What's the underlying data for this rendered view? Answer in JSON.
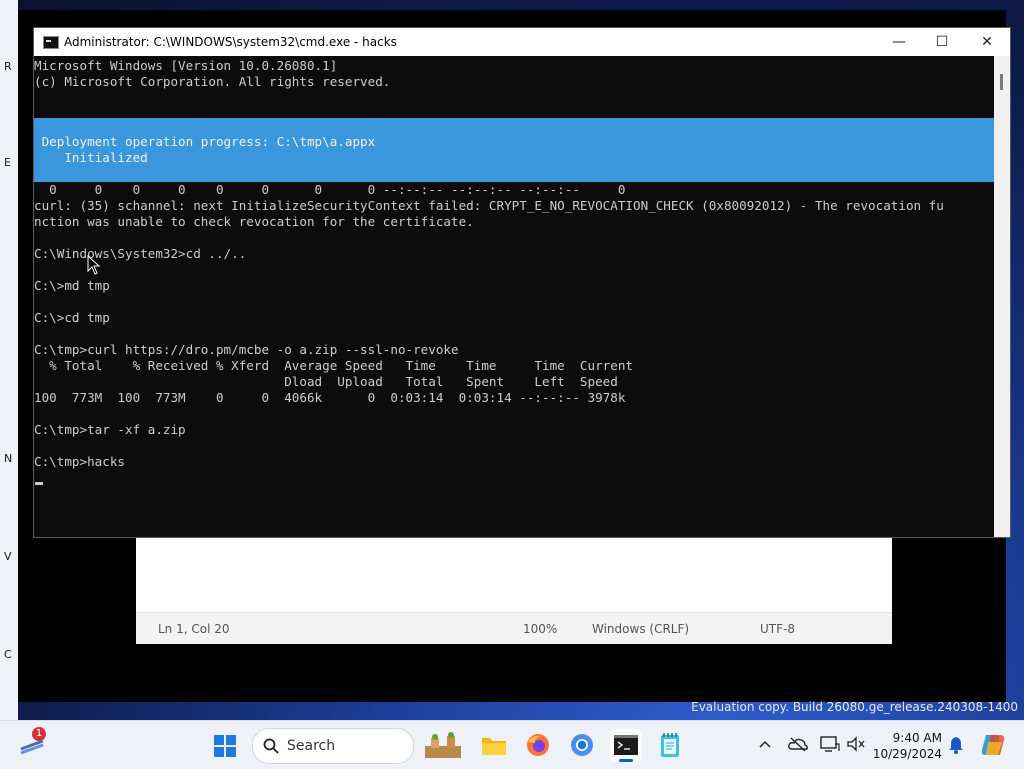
{
  "desktop": {
    "left_labels": [
      "R",
      "E",
      "N",
      "V",
      "C"
    ],
    "watermark": "Evaluation copy. Build 26080.ge_release.240308-1400"
  },
  "notepad": {
    "status": {
      "position": "Ln 1, Col 20",
      "zoom": "100%",
      "line_endings": "Windows (CRLF)",
      "encoding": "UTF-8"
    }
  },
  "cmd_window": {
    "title": "Administrator: C:\\WINDOWS\\system32\\cmd.exe - hacks",
    "buttons": {
      "minimize": "—",
      "maximize": "☐",
      "close": "✕"
    },
    "header_lines": [
      "Microsoft Windows [Version 10.0.26080.1]",
      "(c) Microsoft Corporation. All rights reserved."
    ],
    "progress_lines": [
      " Deployment operation progress: C:\\tmp\\a.appx",
      "    Initialized"
    ],
    "output_lines": [
      "  0     0    0     0    0     0      0      0 --:--:-- --:--:-- --:--:--     0",
      "curl: (35) schannel: next InitializeSecurityContext failed: CRYPT_E_NO_REVOCATION_CHECK (0x80092012) - The revocation fu",
      "nction was unable to check revocation for the certificate.",
      "",
      "C:\\Windows\\System32>cd ../..",
      "",
      "C:\\>md tmp",
      "",
      "C:\\>cd tmp",
      "",
      "C:\\tmp>curl https://dro.pm/mcbe -o a.zip --ssl-no-revoke",
      "  % Total    % Received % Xferd  Average Speed   Time    Time     Time  Current",
      "                                 Dload  Upload   Total   Spent    Left  Speed",
      "100  773M  100  773M    0     0  4066k      0  0:03:14  0:03:14 --:--:-- 3978k",
      "",
      "C:\\tmp>tar -xf a.zip",
      "",
      "C:\\tmp>hacks"
    ]
  },
  "taskbar": {
    "notification_count": "1",
    "search_label": "Search",
    "apps": [
      "start-icon",
      "search-icon",
      "widgets-icon",
      "file-explorer-icon",
      "firefox-icon",
      "chrome-icon",
      "terminal-icon",
      "notepad-icon"
    ],
    "tray_icons": [
      "chevron-up-icon",
      "onedrive-icon",
      "display-icon",
      "volume-icon"
    ],
    "time": "9:40 AM",
    "date": "10/29/2024"
  }
}
